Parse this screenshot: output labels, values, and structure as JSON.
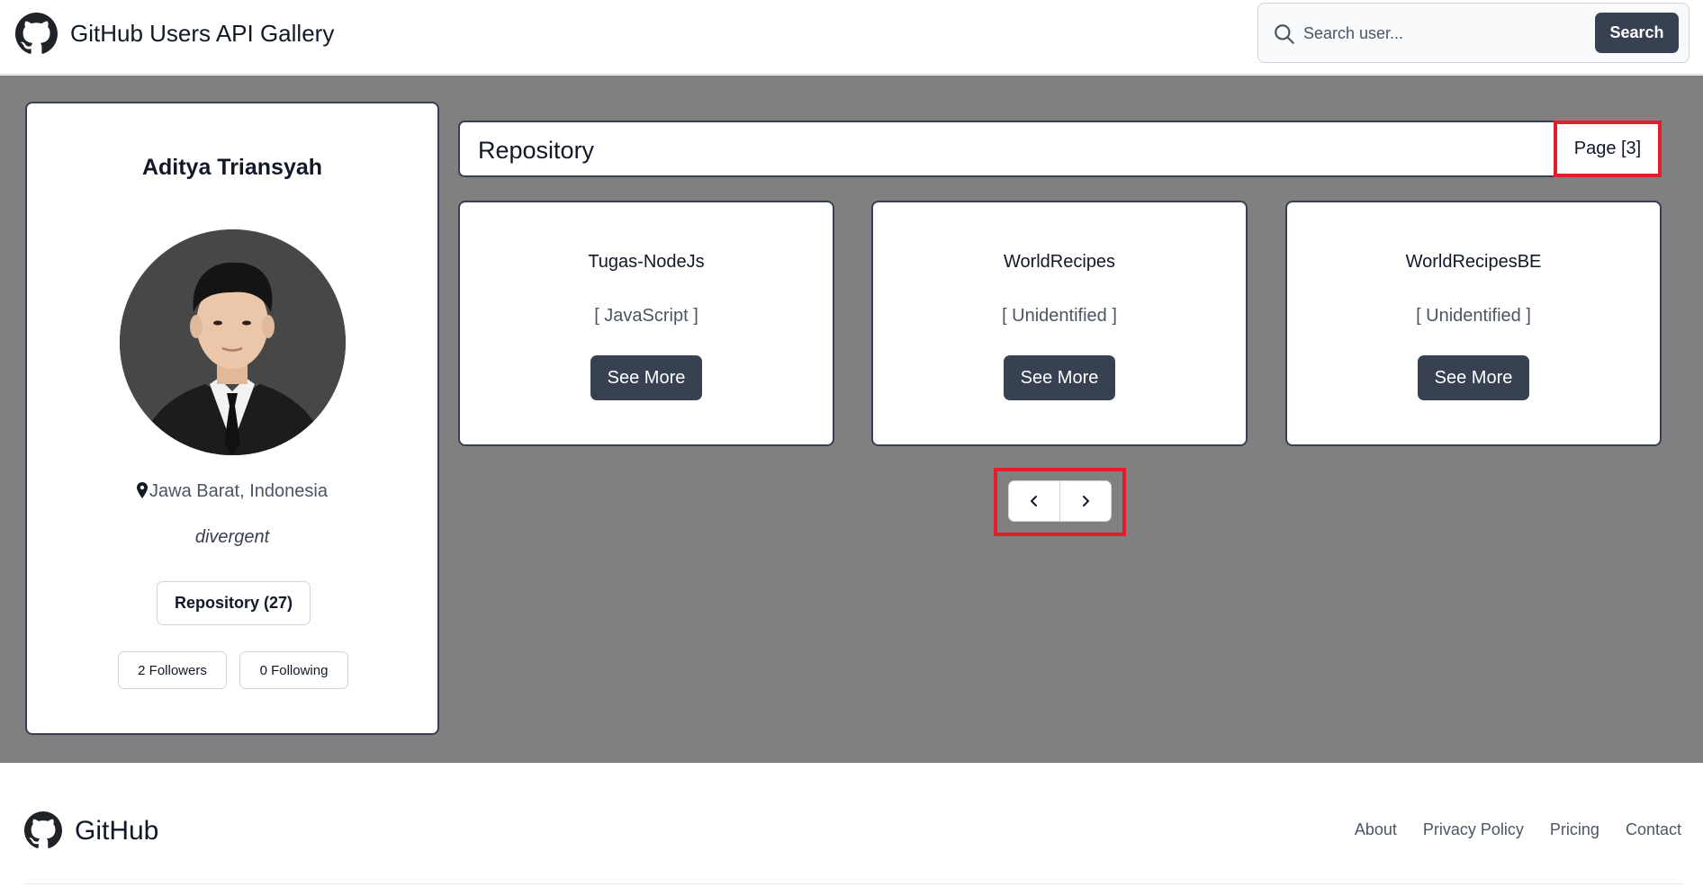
{
  "header": {
    "title": "GitHub Users API Gallery",
    "logo_icon": "github-icon",
    "search": {
      "placeholder": "Search user...",
      "value": "",
      "button_label": "Search",
      "icon": "search-icon"
    }
  },
  "profile": {
    "name": "Aditya Triansyah",
    "location": "Jawa Barat, Indonesia",
    "bio": "divergent",
    "repository_label": "Repository (27)",
    "followers_label": "2 Followers",
    "following_label": "0 Following"
  },
  "repositories": {
    "title": "Repository",
    "page_label": "Page [3]",
    "items": [
      {
        "name": "Tugas-NodeJs",
        "language": "[ JavaScript ]",
        "button_label": "See More"
      },
      {
        "name": "WorldRecipes",
        "language": "[ Unidentified ]",
        "button_label": "See More"
      },
      {
        "name": "WorldRecipesBE",
        "language": "[ Unidentified ]",
        "button_label": "See More"
      }
    ],
    "pagination": {
      "prev_icon": "chevron-left-icon",
      "next_icon": "chevron-right-icon"
    }
  },
  "footer": {
    "brand": "GitHub",
    "links": [
      "About",
      "Privacy Policy",
      "Pricing",
      "Contact"
    ]
  },
  "colors": {
    "accent": "#374151",
    "background": "#808080",
    "highlight": "#e11d2e"
  }
}
